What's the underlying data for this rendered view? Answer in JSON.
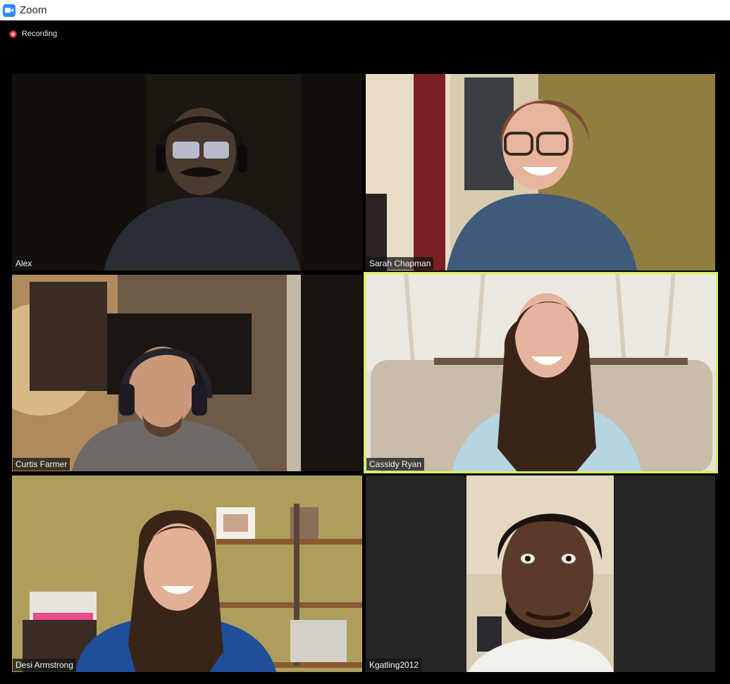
{
  "window": {
    "title": "Zoom"
  },
  "recording": {
    "label": "Recording",
    "color": "#e33b3b"
  },
  "active_speaker_color": "#d6f05a",
  "participants": [
    {
      "name": "Alex"
    },
    {
      "name": "Sarah Chapman"
    },
    {
      "name": "Curtis Farmer"
    },
    {
      "name": "Cassidy Ryan",
      "active_speaker": true
    },
    {
      "name": "Desi Armstrong"
    },
    {
      "name": "Kgatling2012"
    }
  ]
}
